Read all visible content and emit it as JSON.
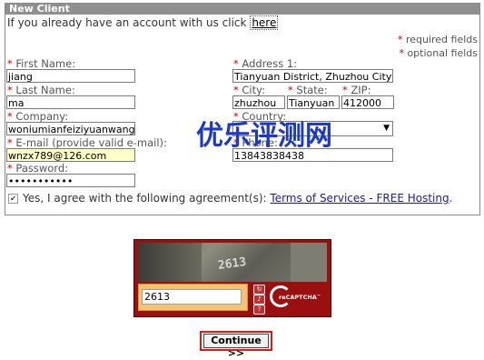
{
  "panel": {
    "title": "New Client",
    "intro_text": "If you already have an account with us click",
    "intro_link": "here",
    "intro_end": "."
  },
  "legend": {
    "required": "required fields",
    "optional": "optional fields"
  },
  "left": {
    "first_name": {
      "label": "First Name:",
      "value": "jiang"
    },
    "last_name": {
      "label": "Last Name:",
      "value": "ma"
    },
    "company": {
      "label": "Company:",
      "value": "woniumianfeiziyuanwang"
    },
    "email": {
      "label": "E-mail (provide valid e-mail):",
      "value": "wnzx789@126.com"
    },
    "password": {
      "label": "Password:",
      "value": "•••••••••••"
    }
  },
  "right": {
    "address": {
      "label": "Address 1:",
      "value": "Tianyuan District, Zhuzhou City, Hunan Province"
    },
    "city": {
      "label": "City:",
      "value": "zhuzhou"
    },
    "state": {
      "label": "State:",
      "value": "Tianyuan"
    },
    "zip": {
      "label": "ZIP:",
      "value": "412000"
    },
    "country": {
      "label": "Country:",
      "value": ""
    },
    "phone": {
      "label": "Phone:",
      "value": "13843838438"
    }
  },
  "agreement": {
    "text": "Yes, I agree with the following agreement(s):",
    "link": "Terms of Services - FREE Hosting",
    "end": "."
  },
  "watermark": "优乐评测网",
  "captcha": {
    "word": "2613",
    "input_value": "2613",
    "brand": "reCAPTCHA"
  },
  "continue_label": "Continue >>",
  "colors": {
    "header": "#8f8f8f",
    "required_star": "#cc0000",
    "captcha_red": "#9a1010",
    "highlight": "#e01818"
  }
}
